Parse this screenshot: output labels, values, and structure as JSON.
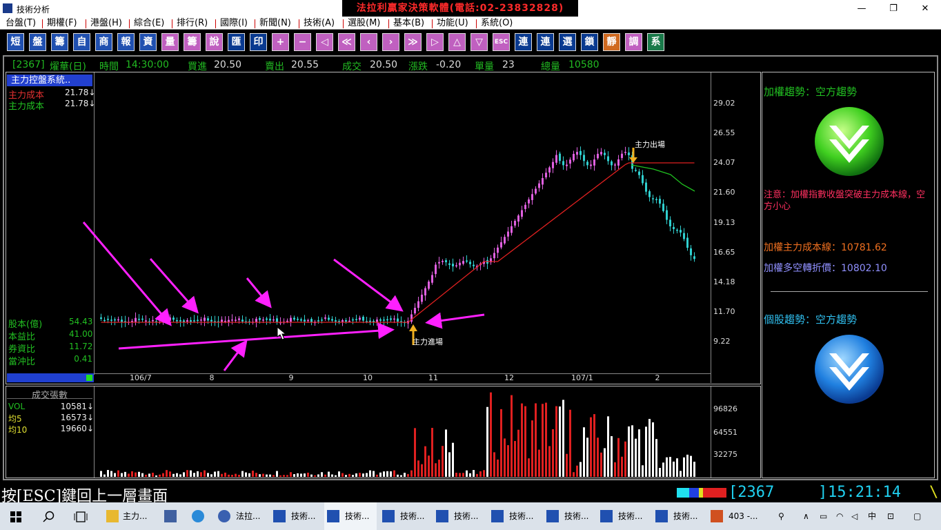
{
  "window": {
    "title": "技術分析",
    "banner": "法拉利贏家決策軟體(電話:02-23832828)",
    "minimize": "—",
    "restore": "❐",
    "close": "✕"
  },
  "menu": [
    "台盤(T)",
    "期權(F)",
    "港盤(H)",
    "綜合(E)",
    "排行(R)",
    "國際(I)",
    "新聞(N)",
    "技術(A)",
    "選股(M)",
    "基本(B)",
    "功能(U)",
    "系統(O)"
  ],
  "toolbar": [
    "短",
    "盤",
    "籌",
    "自",
    "商",
    "報",
    "資",
    "量",
    "籌",
    "說",
    "匯",
    "印",
    "+",
    "−",
    "◁",
    "≪",
    "‹",
    "›",
    "≫",
    "▷",
    "△",
    "▽",
    "ESC",
    "連",
    "連",
    "選",
    "鎖",
    "靜",
    "調",
    "系"
  ],
  "quote": {
    "code": "[2367]",
    "name": "燿華(日)",
    "time_label": "時間",
    "time": "14:30:00",
    "bid_label": "買進",
    "bid": "20.50",
    "ask_label": "賣出",
    "ask": "20.55",
    "deal_label": "成交",
    "deal": "20.50",
    "change_label": "漲跌",
    "change": "-0.20",
    "vol_label": "單量",
    "vol": "23",
    "total_label": "總量",
    "total": "10580"
  },
  "price_panel": {
    "system_label": "主力控盤系統..",
    "cost1_label": "主力成本",
    "cost1_value": "21.78↓",
    "cost2_label": "主力成本",
    "cost2_value": "21.78↓",
    "fundamentals": [
      {
        "label": "股本(億)",
        "value": "54.43"
      },
      {
        "label": "本益比",
        "value": "41.00"
      },
      {
        "label": "券資比",
        "value": "11.72"
      },
      {
        "label": "當沖比",
        "value": "0.41"
      }
    ],
    "y_ticks": [
      "29.02",
      "26.55",
      "24.07",
      "21.60",
      "19.13",
      "16.65",
      "14.18",
      "11.70",
      "9.22"
    ],
    "x_ticks": [
      "106/7",
      "8",
      "9",
      "10",
      "11",
      "12",
      "107/1",
      "2"
    ],
    "annot_exit": "主力出場",
    "annot_enter": "主力進場"
  },
  "volume_panel": {
    "title": "成交張數",
    "rows": [
      {
        "label": "VOL",
        "value": "10581↓"
      },
      {
        "label": "均5",
        "value": "16573↓"
      },
      {
        "label": "均10",
        "value": "19660↓"
      }
    ],
    "y_ticks": [
      "96826",
      "64551",
      "32275"
    ]
  },
  "side_panel": {
    "index_trend": "加權趨勢：空方趨勢",
    "note": "注意：加權指數收盤突破主力成本線，空方小心",
    "cost_line_label": "加權主力成本線：",
    "cost_line_value": "10781.62",
    "pivot_label": "加權多空轉折價：",
    "pivot_value": "10802.10",
    "stock_trend": "個股趨勢：空方趨勢"
  },
  "status": {
    "hint": "按[ESC]鍵回上一層畫面",
    "code": "[2367",
    "bracket": "]",
    "clock": "15:21:14",
    "spinner": "\\"
  },
  "taskbar": {
    "items": [
      "主力...",
      "",
      "",
      "法拉...",
      "技術...",
      "技術...",
      "技術...",
      "技術...",
      "技術...",
      "技術...",
      "技術...",
      "技術...",
      "403 -..."
    ],
    "ime": "中"
  },
  "colors": {
    "up": "#e060e0",
    "down": "#30d0d0",
    "cost_line": "#e02020",
    "avg_line": "#20c020",
    "arrow": "#ff20ff",
    "vol_up": "#e02020",
    "vol_down": "#ffffff"
  }
}
